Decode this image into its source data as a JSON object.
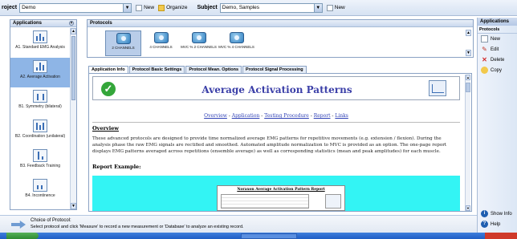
{
  "topbar": {
    "project_label": "roject",
    "project_value": "Demo",
    "new_label": "New",
    "organize_label": "Organize",
    "subject_label": "Subject",
    "subject_value": "Demo, Samples",
    "new_subject_label": "New"
  },
  "applications": {
    "title": "Applications",
    "items": [
      {
        "label": "A1. Standard EMG Analysis",
        "selected": false
      },
      {
        "label": "A2. Average Activation",
        "selected": true
      },
      {
        "label": "B1. Symmetry (bilateral)",
        "selected": false
      },
      {
        "label": "B2. Coordination (unilateral)",
        "selected": false
      },
      {
        "label": "B3. Feedback Training",
        "selected": false
      },
      {
        "label": "B4. Incontinence",
        "selected": false
      }
    ]
  },
  "protocols": {
    "title": "Protocols",
    "items": [
      {
        "label": "2 CHANNELS",
        "selected": true
      },
      {
        "label": "4 CHANNELS",
        "selected": false
      },
      {
        "label": "MVC % 2 CHANNELS",
        "selected": false
      },
      {
        "label": "MVC % 4 CHANNELS",
        "selected": false
      }
    ]
  },
  "tabs": [
    {
      "label": "Application Info",
      "active": true
    },
    {
      "label": "Protocol Basic Settings",
      "active": false
    },
    {
      "label": "Protocol Mean. Options",
      "active": false
    },
    {
      "label": "Protocol Signal Processing",
      "active": false
    }
  ],
  "document": {
    "title": "Average Activation Patterns",
    "nav": {
      "overview": "Overview",
      "application": "Application",
      "testing": "Testing  Procedure",
      "report": "Report",
      "links": "Links",
      "sep": " - "
    },
    "overview_heading": "Overview",
    "overview_text": "These advanced protocols are designed to provide time normalized average EMG patterns for repetitive movements (e.g. extension / flexion). During the analysis phase the raw EMG signals are rectified and smoothed. Automated amplitude normalization to MVC is provided as an option. The one-page report displays EMG patterns averaged across repetitions (ensemble average) as well as corresponding statistics (mean and peak amplitudes) for each muscle.",
    "report_heading": "Report Example:",
    "report_sheet_title": "Noraxon Average Activation Pattern Report"
  },
  "right_panel": {
    "header": "Applications",
    "section": "Protocols",
    "buttons": [
      {
        "label": "New",
        "icon": "new-icon"
      },
      {
        "label": "Edit",
        "icon": "edit-icon"
      },
      {
        "label": "Delete",
        "icon": "delete-icon"
      },
      {
        "label": "Copy",
        "icon": "copy-icon"
      }
    ],
    "show_info": "Show Info",
    "help": "Help"
  },
  "hint": {
    "title": "Choice of Protocol:",
    "text": "Select protocol and click 'Measure' to record a new measurement or 'Database' to analyze an existing record."
  },
  "colors": {
    "accent": "#8eb5e6",
    "title_blue": "#3b3fa8",
    "report_bg": "#33f4f4",
    "logo_green": "#34a63a"
  }
}
